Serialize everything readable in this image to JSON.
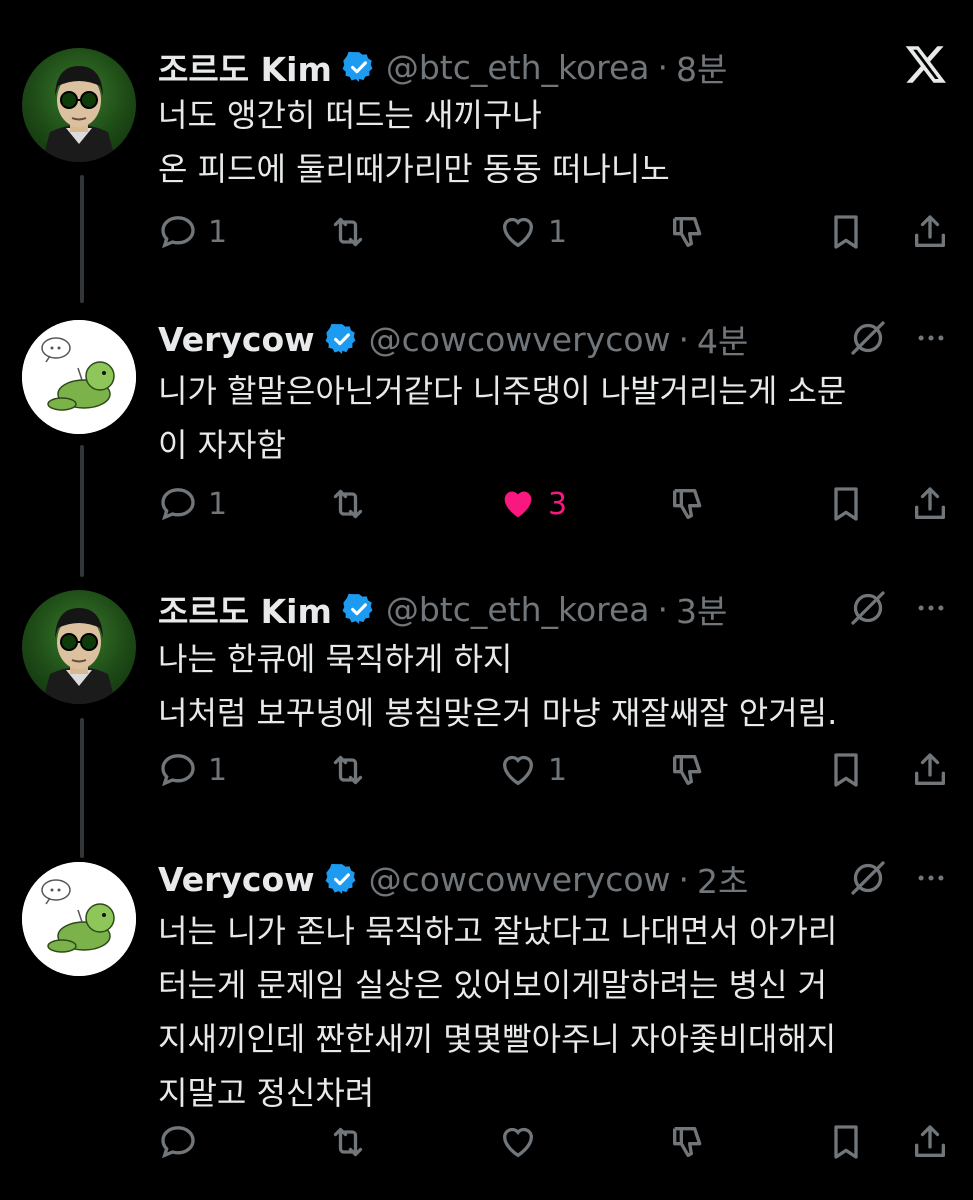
{
  "tweets": [
    {
      "name": "조르도 Kim",
      "handle": "@btc_eth_korea",
      "time": "8분",
      "lines": [
        "너도 앵간히 떠드는 새끼구나",
        "온 피드에 둘리때가리만 동동 떠나니노"
      ],
      "replies": "1",
      "likes": "1",
      "liked": false,
      "top_icon": "x-logo-icon"
    },
    {
      "name": "Verycow",
      "handle": "@cowcowverycow",
      "time": "4분",
      "lines": [
        "니가 할말은아닌거같다 니주댕이 나발거리는게 소문",
        "이 자자함"
      ],
      "replies": "1",
      "likes": "3",
      "liked": true,
      "top_icon": "grok-icon"
    },
    {
      "name": "조르도 Kim",
      "handle": "@btc_eth_korea",
      "time": "3분",
      "lines": [
        "나는 한큐에 묵직하게 하지",
        "너처럼 보꾸녕에 봉침맞은거 마냥 재잘쌔잘 안거림."
      ],
      "replies": "1",
      "likes": "1",
      "liked": false,
      "top_icon": "grok-icon"
    },
    {
      "name": "Verycow",
      "handle": "@cowcowverycow",
      "time": "2초",
      "lines": [
        "너는 니가 존나 묵직하고 잘났다고 나대면서 아가리",
        "터는게 문제임 실상은 있어보이게말하려는 병신 거",
        "지새끼인데 짠한새끼 몇몇빨아주니 자아좇비대해지",
        "지말고 정신차려"
      ],
      "replies": "",
      "likes": "",
      "liked": false,
      "top_icon": "grok-icon"
    }
  ],
  "colors": {
    "accent": "#1d9bf0",
    "like": "#f91880",
    "muted": "#71767b",
    "text": "#e7e9ea"
  }
}
